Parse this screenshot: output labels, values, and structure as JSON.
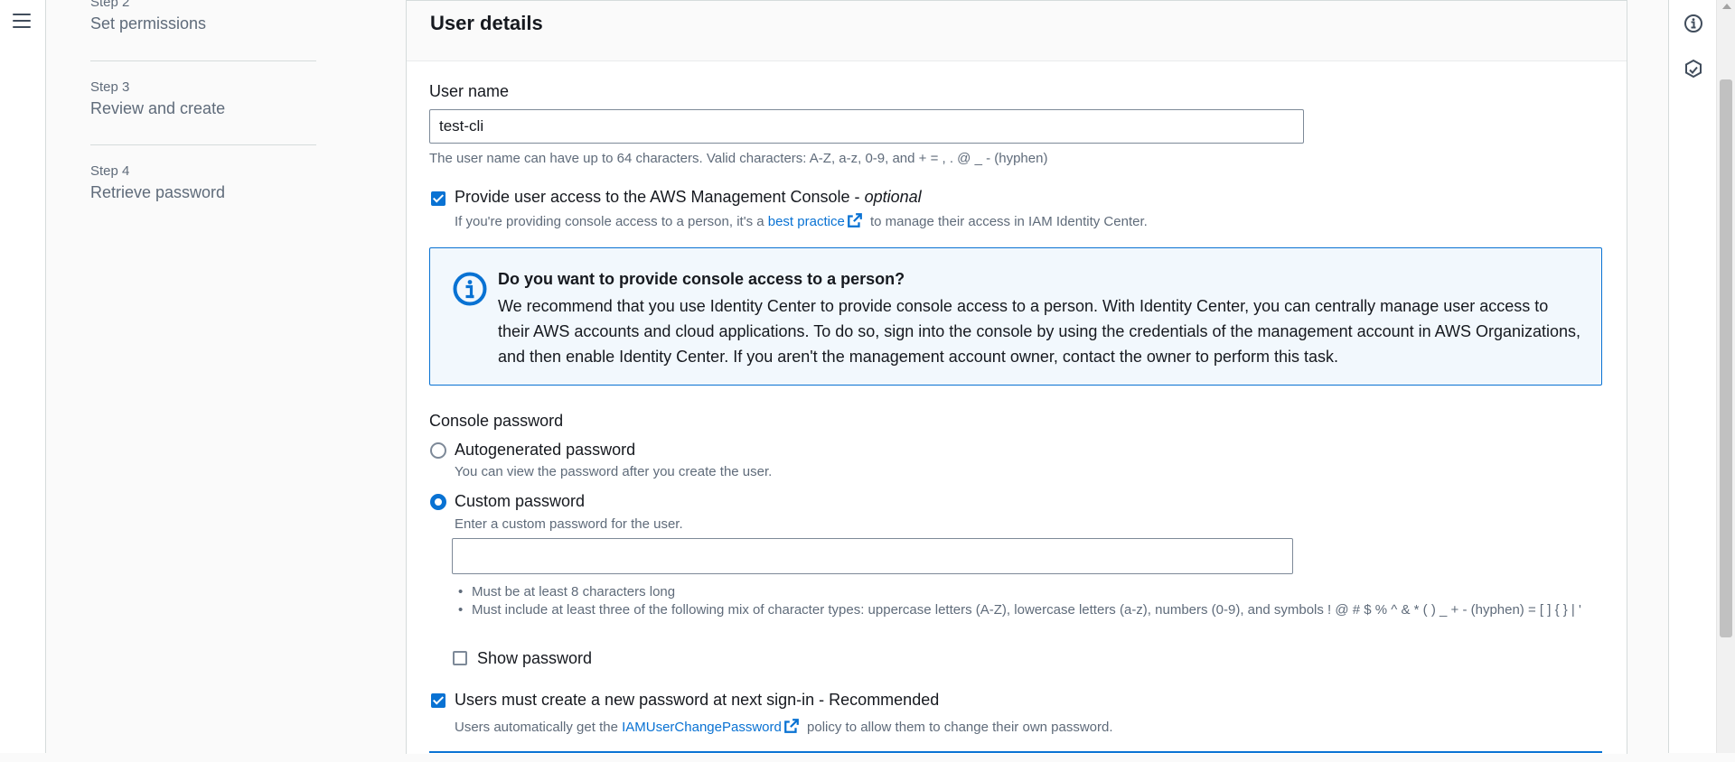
{
  "steps": [
    {
      "num": "Step 2",
      "title": "Set permissions"
    },
    {
      "num": "Step 3",
      "title": "Review and create"
    },
    {
      "num": "Step 4",
      "title": "Retrieve password"
    }
  ],
  "panel": {
    "title": "User details"
  },
  "user_name": {
    "label": "User name",
    "value": "test-cli",
    "hint": "The user name can have up to 64 characters. Valid characters: A-Z, a-z, 0-9, and + = , . @ _ - (hyphen)"
  },
  "console_access": {
    "checked": true,
    "label": "Provide user access to the AWS Management Console - ",
    "optional": "optional",
    "hint_pre": "If you're providing console access to a person, it's a ",
    "hint_link": "best practice",
    "hint_post": " to manage their access in IAM Identity Center."
  },
  "info_box": {
    "title": "Do you want to provide console access to a person?",
    "body": "We recommend that you use Identity Center to provide console access to a person. With Identity Center, you can centrally manage user access to their AWS accounts and cloud applications. To do so, sign into the console by using the credentials of the management account in AWS Organizations, and then enable Identity Center. If you aren't the management account owner, contact the owner to perform this task."
  },
  "console_password": {
    "label": "Console password",
    "autogen": {
      "label": "Autogenerated password",
      "hint": "You can view the password after you create the user.",
      "selected": false
    },
    "custom": {
      "label": "Custom password",
      "hint": "Enter a custom password for the user.",
      "selected": true,
      "value": ""
    },
    "rules": [
      "Must be at least 8 characters long",
      "Must include at least three of the following mix of character types: uppercase letters (A-Z), lowercase letters (a-z), numbers (0-9), and symbols ! @ # $ % ^ & * ( ) _ + - (hyphen) = [ ] { } | '"
    ],
    "show_password": {
      "label": "Show password",
      "checked": false
    }
  },
  "reset_required": {
    "checked": true,
    "label": "Users must create a new password at next sign-in - Recommended",
    "hint_pre": "Users automatically get the ",
    "hint_link": "IAMUserChangePassword",
    "hint_post": " policy to allow them to change their own password."
  },
  "colors": {
    "accent": "#0972d3",
    "text": "#16191f",
    "muted": "#5f6b7a",
    "info_bg": "#f2f8fd"
  },
  "icons": {
    "menu": "hamburger-icon",
    "info": "info-icon",
    "feedback": "hexagon-icon",
    "external": "external-link-icon"
  }
}
